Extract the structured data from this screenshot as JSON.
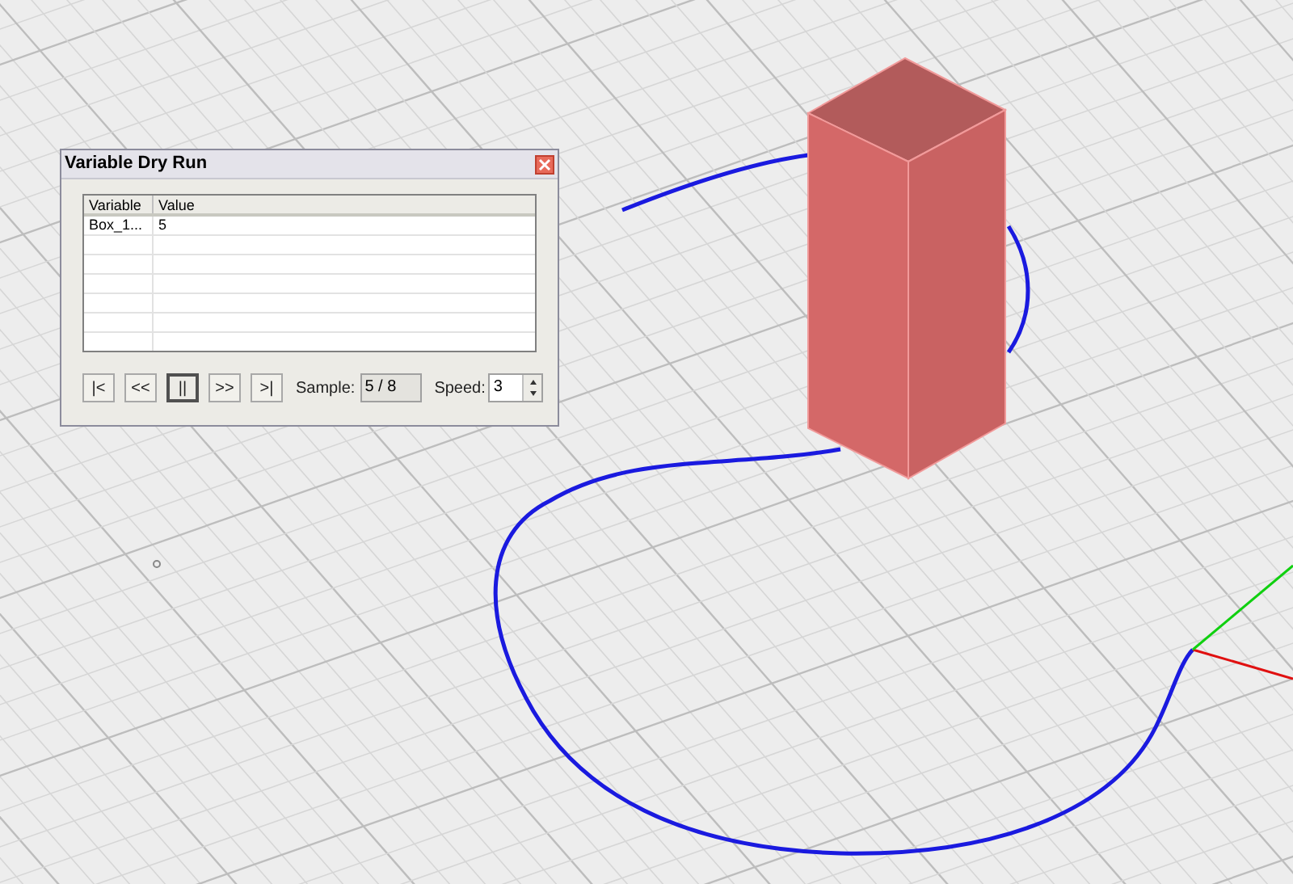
{
  "dialog": {
    "title": "Variable Dry Run",
    "table": {
      "columns": [
        "Variable",
        "Value"
      ],
      "rows": [
        [
          "Box_1...",
          "5"
        ]
      ]
    },
    "buttons": [
      {
        "label": "|<",
        "selected": false
      },
      {
        "label": "<<",
        "selected": false
      },
      {
        "label": "||",
        "selected": true
      },
      {
        "label": ">>",
        "selected": false
      },
      {
        "label": ">|",
        "selected": false
      }
    ],
    "sample": {
      "label": "Sample:",
      "value": "5 / 8"
    },
    "speed": {
      "label": "Speed:",
      "value": "3"
    }
  }
}
